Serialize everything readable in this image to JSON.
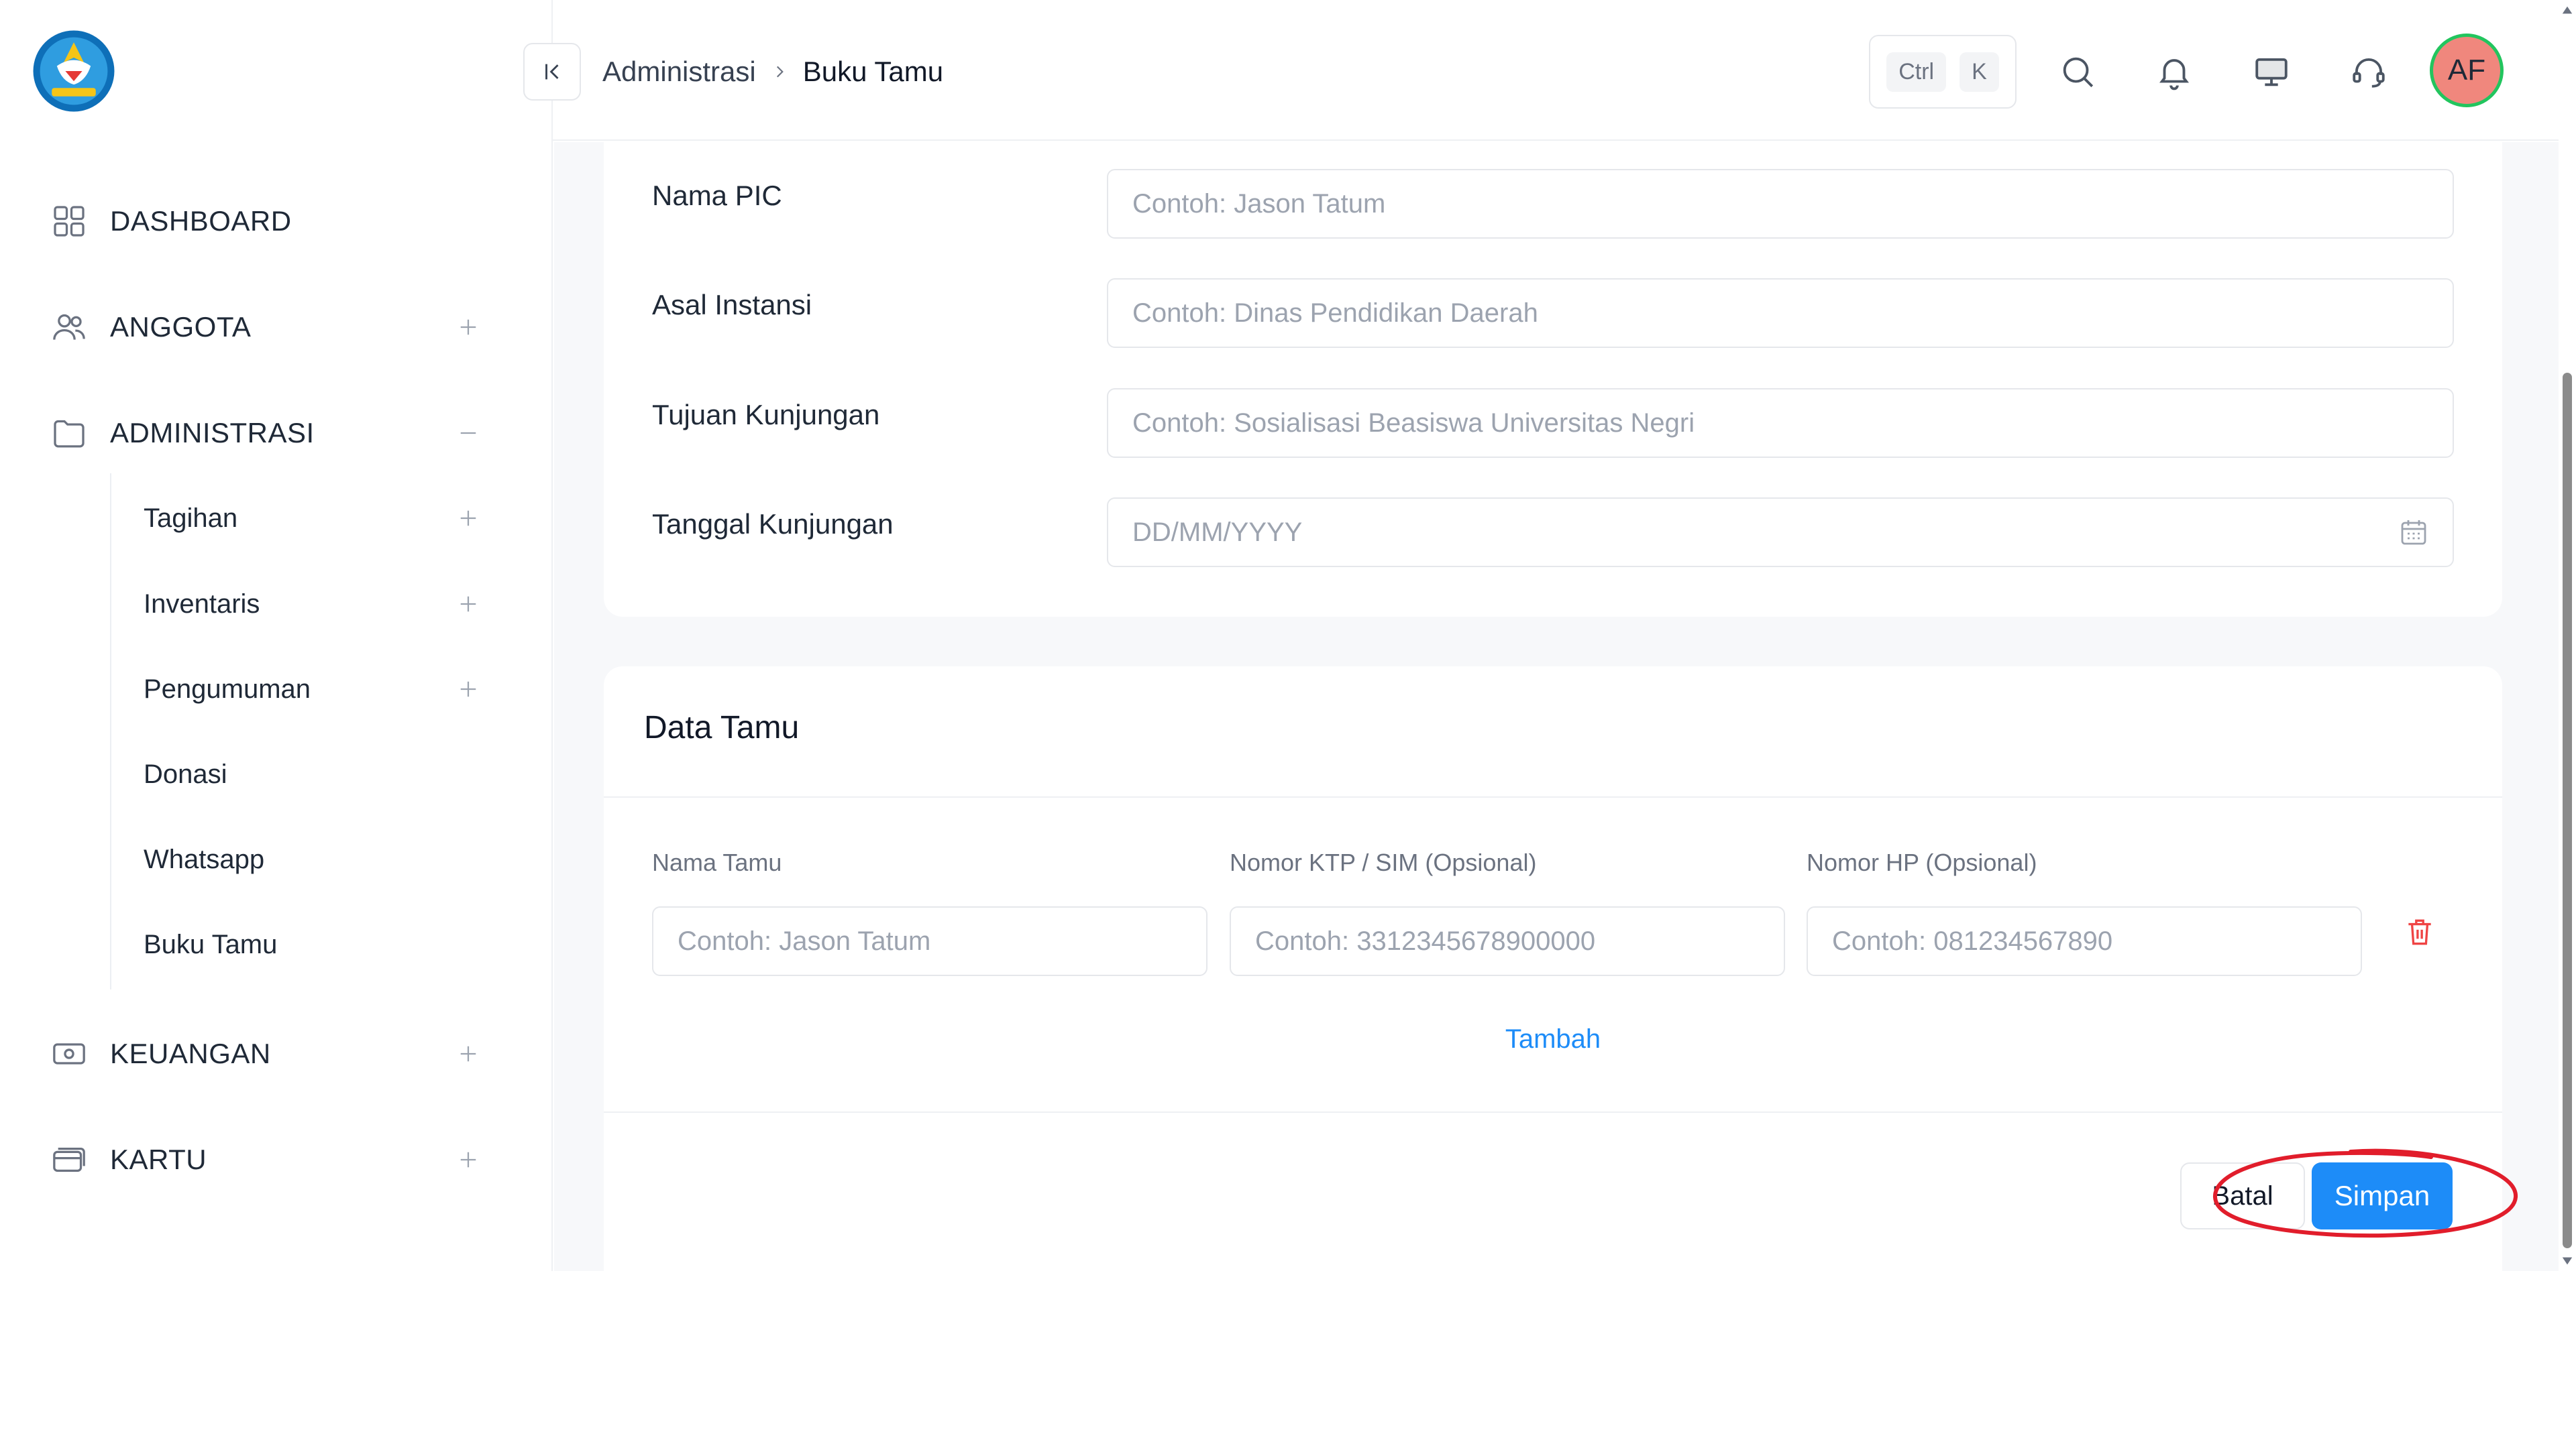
{
  "sidebar": {
    "items": [
      {
        "label": "DASHBOARD",
        "icon": "grid-icon"
      },
      {
        "label": "ANGGOTA",
        "icon": "users-icon",
        "toggle": "+"
      },
      {
        "label": "ADMINISTRASI",
        "icon": "folder-icon",
        "toggle": "−"
      },
      {
        "label": "KEUANGAN",
        "icon": "money-icon",
        "toggle": "+"
      },
      {
        "label": "KARTU",
        "icon": "card-icon",
        "toggle": "+"
      }
    ],
    "sub_items": [
      {
        "label": "Tagihan",
        "toggle": "+"
      },
      {
        "label": "Inventaris",
        "toggle": "+"
      },
      {
        "label": "Pengumuman",
        "toggle": "+"
      },
      {
        "label": "Donasi"
      },
      {
        "label": "Whatsapp"
      },
      {
        "label": "Buku Tamu"
      }
    ]
  },
  "header": {
    "breadcrumb_parent": "Administrasi",
    "breadcrumb_current": "Buku Tamu",
    "shortcut_keys": [
      "Ctrl",
      "K"
    ],
    "avatar_initials": "AF"
  },
  "form": {
    "fields": [
      {
        "label": "Nama PIC",
        "placeholder": "Contoh: Jason Tatum"
      },
      {
        "label": "Asal Instansi",
        "placeholder": "Contoh: Dinas Pendidikan Daerah"
      },
      {
        "label": "Tujuan Kunjungan",
        "placeholder": "Contoh: Sosialisasi Beasiswa Universitas Negri"
      },
      {
        "label": "Tanggal Kunjungan",
        "placeholder": "DD/MM/YYYY"
      }
    ]
  },
  "guests": {
    "title": "Data Tamu",
    "columns": [
      {
        "label": "Nama Tamu",
        "placeholder": "Contoh: Jason Tatum"
      },
      {
        "label": "Nomor KTP / SIM (Opsional)",
        "placeholder": "Contoh: 3312345678900000"
      },
      {
        "label": "Nomor HP (Opsional)",
        "placeholder": "Contoh: 081234567890"
      }
    ],
    "add_label": "Tambah"
  },
  "actions": {
    "cancel_label": "Batal",
    "save_label": "Simpan"
  },
  "colors": {
    "accent": "#1d8cf8",
    "danger": "#ef4444",
    "annotation": "#e11d2b",
    "avatar_bg": "#f0877d",
    "avatar_ring": "#22c55e"
  }
}
